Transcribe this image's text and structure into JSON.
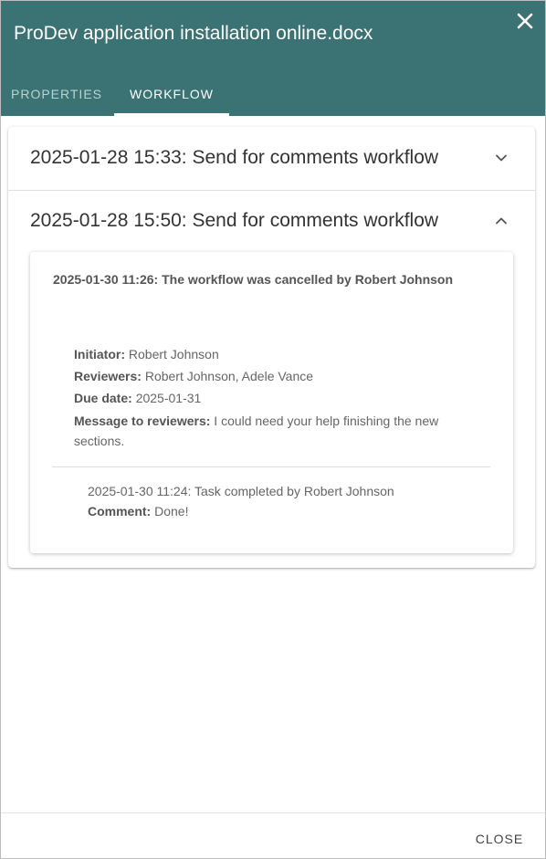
{
  "dialog": {
    "title": "ProDev application installation online.docx",
    "tabs": [
      {
        "label": "PROPERTIES",
        "active": false
      },
      {
        "label": "WORKFLOW",
        "active": true
      }
    ],
    "close_label": "CLOSE"
  },
  "workflows": [
    {
      "title": "2025-01-28 15:33: Send for comments workflow",
      "expanded": false,
      "chevron_icon": "chevron-down-icon"
    },
    {
      "title": "2025-01-28 15:50: Send for comments workflow",
      "expanded": true,
      "chevron_icon": "chevron-up-icon",
      "status": "2025-01-30 11:26: The workflow was cancelled by Robert Johnson",
      "initiator_label": "Initiator:",
      "initiator": "Robert Johnson",
      "reviewers_label": "Reviewers:",
      "reviewers": "Robert Johnson, Adele Vance",
      "due_date_label": "Due date:",
      "due_date": "2025-01-31",
      "message_label": "Message to reviewers:",
      "message": "I could need your help finishing the new sections.",
      "task": {
        "text": "2025-01-30 11:24: Task completed by Robert Johnson",
        "comment_label": "Comment:",
        "comment": "Done!"
      }
    }
  ],
  "colors": {
    "header_bg": "#3b7374",
    "active_tab": "#ffffff",
    "inactive_tab": "#bcd1d2"
  }
}
